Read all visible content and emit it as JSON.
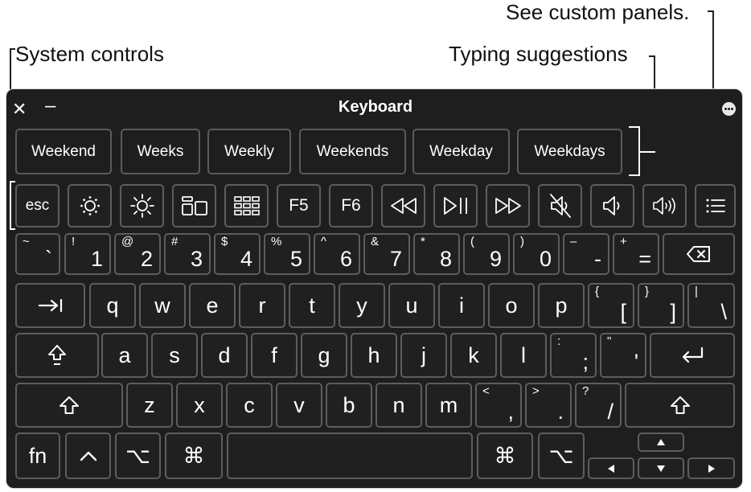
{
  "callouts": {
    "custom_panels": "See custom panels.",
    "system_controls": "System controls",
    "typing_suggestions": "Typing suggestions"
  },
  "window": {
    "title": "Keyboard",
    "close_glyph": "✕",
    "minimize_glyph": "–"
  },
  "suggestions": [
    "Weekend",
    "Weeks",
    "Weekly",
    "Weekends",
    "Weekday",
    "Weekdays"
  ],
  "system_row": {
    "esc": "esc",
    "f5": "F5",
    "f6": "F6",
    "icons": [
      "brightness-down-icon",
      "brightness-up-icon",
      "mission-control-icon",
      "launchpad-icon",
      "rewind-icon",
      "play-pause-icon",
      "fast-forward-icon",
      "mute-icon",
      "volume-down-icon",
      "volume-up-icon",
      "list-icon"
    ]
  },
  "number_row": [
    {
      "shift": "~",
      "main": "`"
    },
    {
      "shift": "!",
      "main": "1"
    },
    {
      "shift": "@",
      "main": "2"
    },
    {
      "shift": "#",
      "main": "3"
    },
    {
      "shift": "$",
      "main": "4"
    },
    {
      "shift": "%",
      "main": "5"
    },
    {
      "shift": "^",
      "main": "6"
    },
    {
      "shift": "&",
      "main": "7"
    },
    {
      "shift": "*",
      "main": "8"
    },
    {
      "shift": "(",
      "main": "9"
    },
    {
      "shift": ")",
      "main": "0"
    },
    {
      "shift": "–",
      "main": "-"
    },
    {
      "shift": "+",
      "main": "="
    }
  ],
  "qwerty_row": {
    "letters": [
      "q",
      "w",
      "e",
      "r",
      "t",
      "y",
      "u",
      "i",
      "o",
      "p"
    ],
    "punct": [
      {
        "shift": "{",
        "main": "["
      },
      {
        "shift": "}",
        "main": "]"
      },
      {
        "shift": "|",
        "main": "\\"
      }
    ]
  },
  "home_row": {
    "letters": [
      "a",
      "s",
      "d",
      "f",
      "g",
      "h",
      "j",
      "k",
      "l"
    ],
    "punct": [
      {
        "shift": ":",
        "main": ";"
      },
      {
        "shift": "\"",
        "main": "'"
      }
    ]
  },
  "bottom_letter_row": {
    "letters": [
      "z",
      "x",
      "c",
      "v",
      "b",
      "n",
      "m"
    ],
    "punct": [
      {
        "shift": "<",
        "main": ","
      },
      {
        "shift": ">",
        "main": "."
      },
      {
        "shift": "?",
        "main": "/"
      }
    ]
  },
  "modifier_row": {
    "fn": "fn",
    "control": "^",
    "option": "⌥",
    "command": "⌘"
  }
}
